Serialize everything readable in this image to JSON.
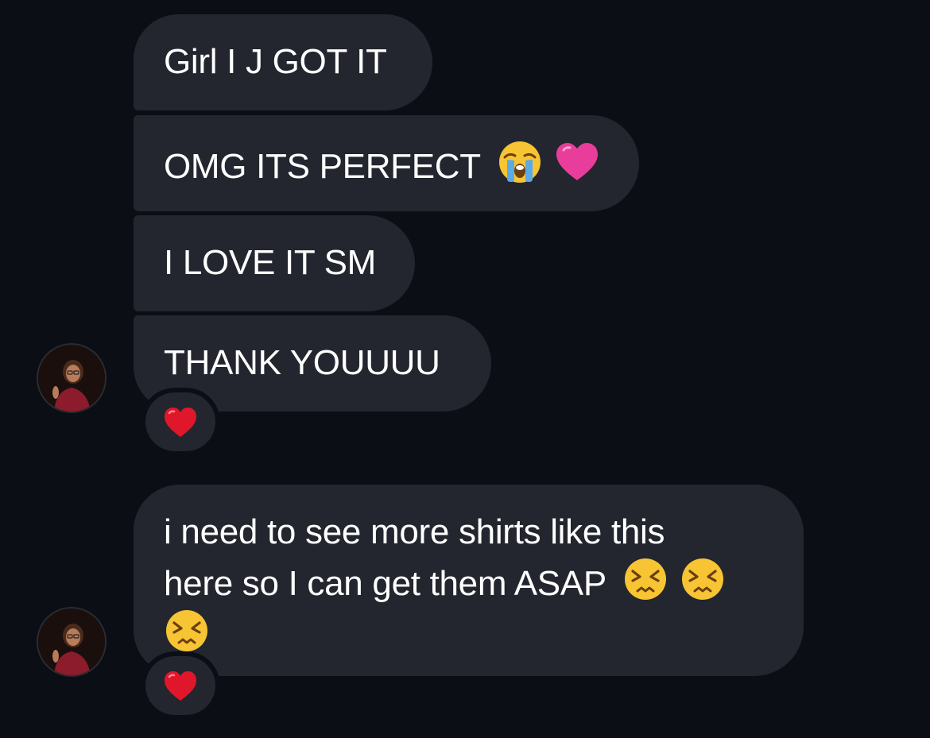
{
  "thread": {
    "messages": [
      {
        "text": "Girl I J GOT IT",
        "emojis": []
      },
      {
        "text": "OMG ITS PERFECT",
        "emojis": [
          "loudly-crying-face-emoji",
          "pink-heart-emoji"
        ]
      },
      {
        "text": "I LOVE IT SM",
        "emojis": []
      },
      {
        "text": "THANK YOUUUU",
        "emojis": [],
        "reaction": "red-heart-emoji"
      },
      {
        "line1": "i need to see more shirts like this",
        "line2": "here so I can get them ASAP",
        "emojis": [
          "persevering-face-emoji",
          "persevering-face-emoji",
          "persevering-face-emoji"
        ],
        "reaction": "red-heart-emoji"
      }
    ]
  },
  "colors": {
    "background": "#0b0e15",
    "bubble": "#23262e",
    "text": "#ffffff",
    "red_heart": "#e0162b",
    "pink_heart": "#e83d9a",
    "emoji_face": "#f7c433"
  }
}
